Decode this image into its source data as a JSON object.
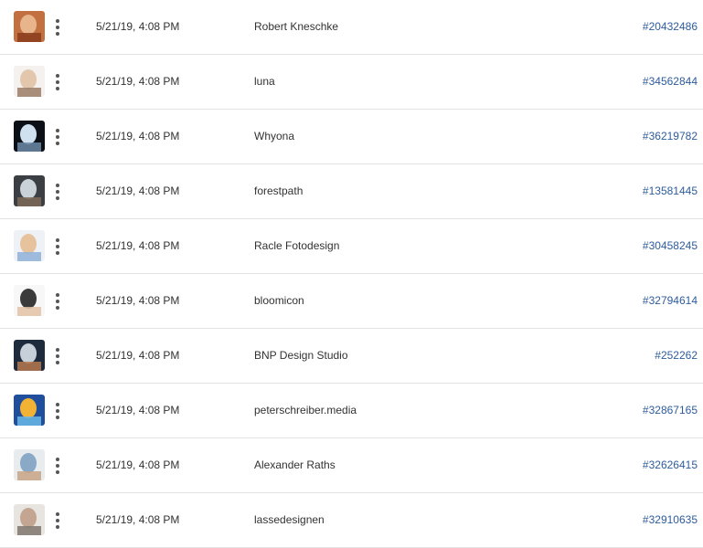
{
  "rows": [
    {
      "thumb_icon": "photo-thumbnail-icon",
      "thumb_colors": [
        "#c2703f",
        "#e7b48c",
        "#8a3b1c"
      ],
      "date": "5/21/19, 4:08 PM",
      "author": "Robert Kneschke",
      "asset_id": "#20432486"
    },
    {
      "thumb_icon": "photo-thumbnail-icon",
      "thumb_colors": [
        "#f4f1ee",
        "#e2c7ad",
        "#9b7d66"
      ],
      "date": "5/21/19, 4:08 PM",
      "author": "luna",
      "asset_id": "#34562844"
    },
    {
      "thumb_icon": "photo-thumbnail-icon",
      "thumb_colors": [
        "#0b1016",
        "#cfe0ee",
        "#6c8aa6"
      ],
      "date": "5/21/19, 4:08 PM",
      "author": "Whyona",
      "asset_id": "#36219782"
    },
    {
      "thumb_icon": "photo-thumbnail-icon",
      "thumb_colors": [
        "#3b3f44",
        "#c9d1d9",
        "#7e6a58"
      ],
      "date": "5/21/19, 4:08 PM",
      "author": "forestpath",
      "asset_id": "#13581445"
    },
    {
      "thumb_icon": "photo-thumbnail-icon",
      "thumb_colors": [
        "#eef2f7",
        "#e6c39c",
        "#8fb1d8"
      ],
      "date": "5/21/19, 4:08 PM",
      "author": "Racle Fotodesign",
      "asset_id": "#30458245"
    },
    {
      "thumb_icon": "photo-thumbnail-icon",
      "thumb_colors": [
        "#f7f7f7",
        "#3a3a3a",
        "#e3c2a4"
      ],
      "date": "5/21/19, 4:08 PM",
      "author": "bloomicon",
      "asset_id": "#32794614"
    },
    {
      "thumb_icon": "photo-thumbnail-icon",
      "thumb_colors": [
        "#1e2b3d",
        "#c7cfd9",
        "#b6794f"
      ],
      "date": "5/21/19, 4:08 PM",
      "author": "BNP Design Studio",
      "asset_id": "#252262"
    },
    {
      "thumb_icon": "photo-thumbnail-icon",
      "thumb_colors": [
        "#1f4f9c",
        "#f2b233",
        "#69b8e8"
      ],
      "date": "5/21/19, 4:08 PM",
      "author": "peterschreiber.media",
      "asset_id": "#32867165"
    },
    {
      "thumb_icon": "photo-thumbnail-icon",
      "thumb_colors": [
        "#e9ecef",
        "#8aa9c6",
        "#c8a585"
      ],
      "date": "5/21/19, 4:08 PM",
      "author": "Alexander Raths",
      "asset_id": "#32626415"
    },
    {
      "thumb_icon": "photo-thumbnail-icon",
      "thumb_colors": [
        "#e8e4e0",
        "#c4a591",
        "#7f756e"
      ],
      "date": "5/21/19, 4:08 PM",
      "author": "lassedesignen",
      "asset_id": "#32910635"
    }
  ],
  "more_icon": "more-vertical-icon"
}
